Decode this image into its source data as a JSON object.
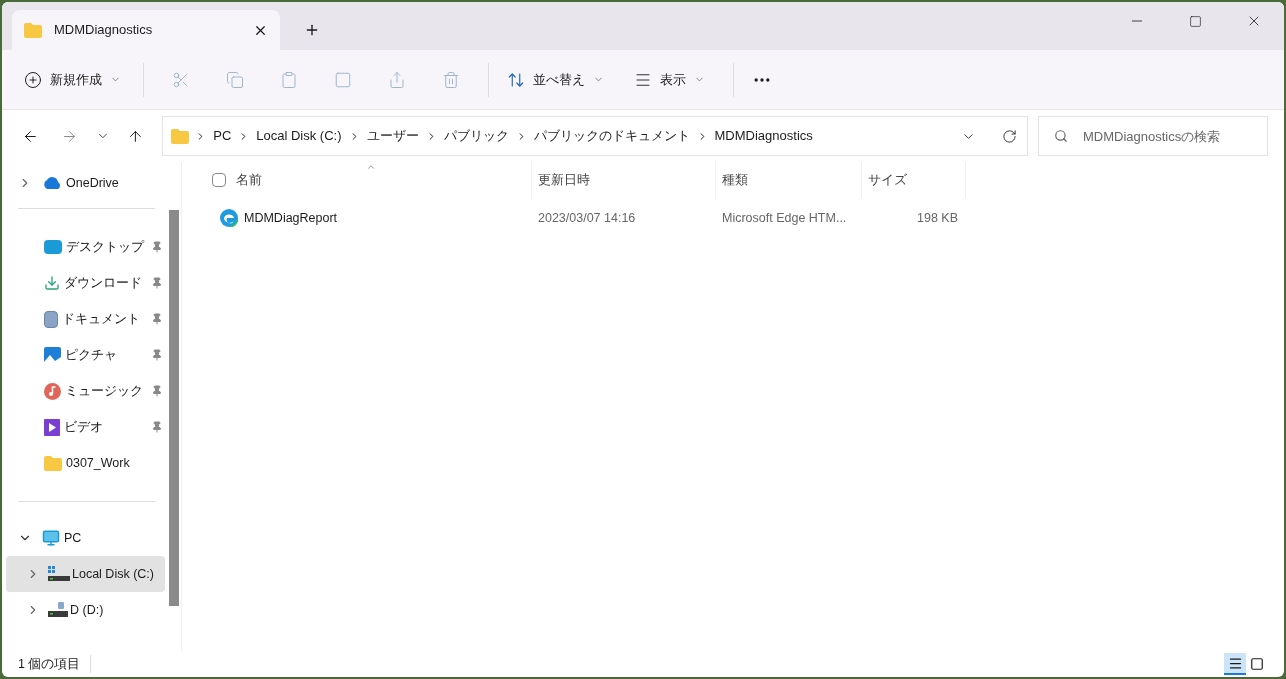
{
  "tab": {
    "title": "MDMDiagnostics"
  },
  "toolbar": {
    "new_label": "新規作成",
    "sort_label": "並べ替え",
    "view_label": "表示"
  },
  "breadcrumb": [
    "PC",
    "Local Disk (C:)",
    "ユーザー",
    "パブリック",
    "パブリックのドキュメント",
    "MDMDiagnostics"
  ],
  "search": {
    "placeholder": "MDMDiagnosticsの検索"
  },
  "sidebar": {
    "onedrive": {
      "label": "OneDrive",
      "expanded": false
    },
    "quick_access": [
      {
        "kind": "desktop",
        "label": "デスクトップ",
        "pinned": true
      },
      {
        "kind": "download",
        "label": "ダウンロード",
        "pinned": true
      },
      {
        "kind": "document",
        "label": "ドキュメント",
        "pinned": true
      },
      {
        "kind": "picture",
        "label": "ピクチャ",
        "pinned": true
      },
      {
        "kind": "music",
        "label": "ミュージック",
        "pinned": true
      },
      {
        "kind": "video",
        "label": "ビデオ",
        "pinned": true
      },
      {
        "kind": "folder",
        "label": "0307_Work",
        "pinned": false
      }
    ],
    "pc": {
      "label": "PC",
      "expanded": true,
      "children": [
        {
          "kind": "system-drive",
          "label": "Local Disk (C:)",
          "selected": true,
          "expanded": false
        },
        {
          "kind": "drive",
          "label": "D (D:)",
          "selected": false,
          "expanded": false
        }
      ]
    }
  },
  "table": {
    "all_checked": false,
    "columns": [
      "名前",
      "更新日時",
      "種類",
      "サイズ"
    ],
    "rows": [
      {
        "name": "MDMDiagReport",
        "modified": "2023/03/07 14:16",
        "type": "Microsoft Edge HTM...",
        "size": "198 KB",
        "checked": false
      }
    ]
  },
  "status_bar": {
    "count": "1 個の項目",
    "view_buttons": [
      {
        "kind": "details",
        "selected": true
      },
      {
        "kind": "tiles",
        "selected": false
      }
    ]
  }
}
